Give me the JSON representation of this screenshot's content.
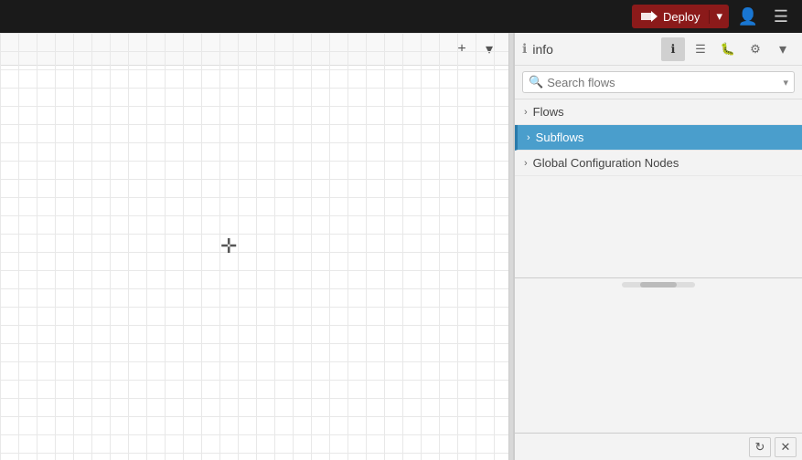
{
  "navbar": {
    "deploy_label": "Deploy",
    "deploy_icon": "⏩",
    "user_icon": "👤",
    "menu_icon": "☰"
  },
  "canvas": {
    "add_label": "+",
    "dropdown_label": "▾",
    "crosshair": "✛"
  },
  "panel": {
    "info_icon": "ℹ",
    "title": "info",
    "tabs": [
      {
        "name": "info-tab",
        "icon": "ℹ",
        "active": true
      },
      {
        "name": "list-tab",
        "icon": "☰",
        "active": false
      },
      {
        "name": "bug-tab",
        "icon": "🐛",
        "active": false
      },
      {
        "name": "settings-tab",
        "icon": "⚙",
        "active": false
      }
    ],
    "more_icon": "▾",
    "search_placeholder": "Search flows",
    "search_dropdown": "▾",
    "tree_items": [
      {
        "label": "Flows",
        "active": false
      },
      {
        "label": "Subflows",
        "active": true
      },
      {
        "label": "Global Configuration Nodes",
        "active": false
      }
    ],
    "refresh_icon": "↻",
    "close_icon": "✕"
  }
}
